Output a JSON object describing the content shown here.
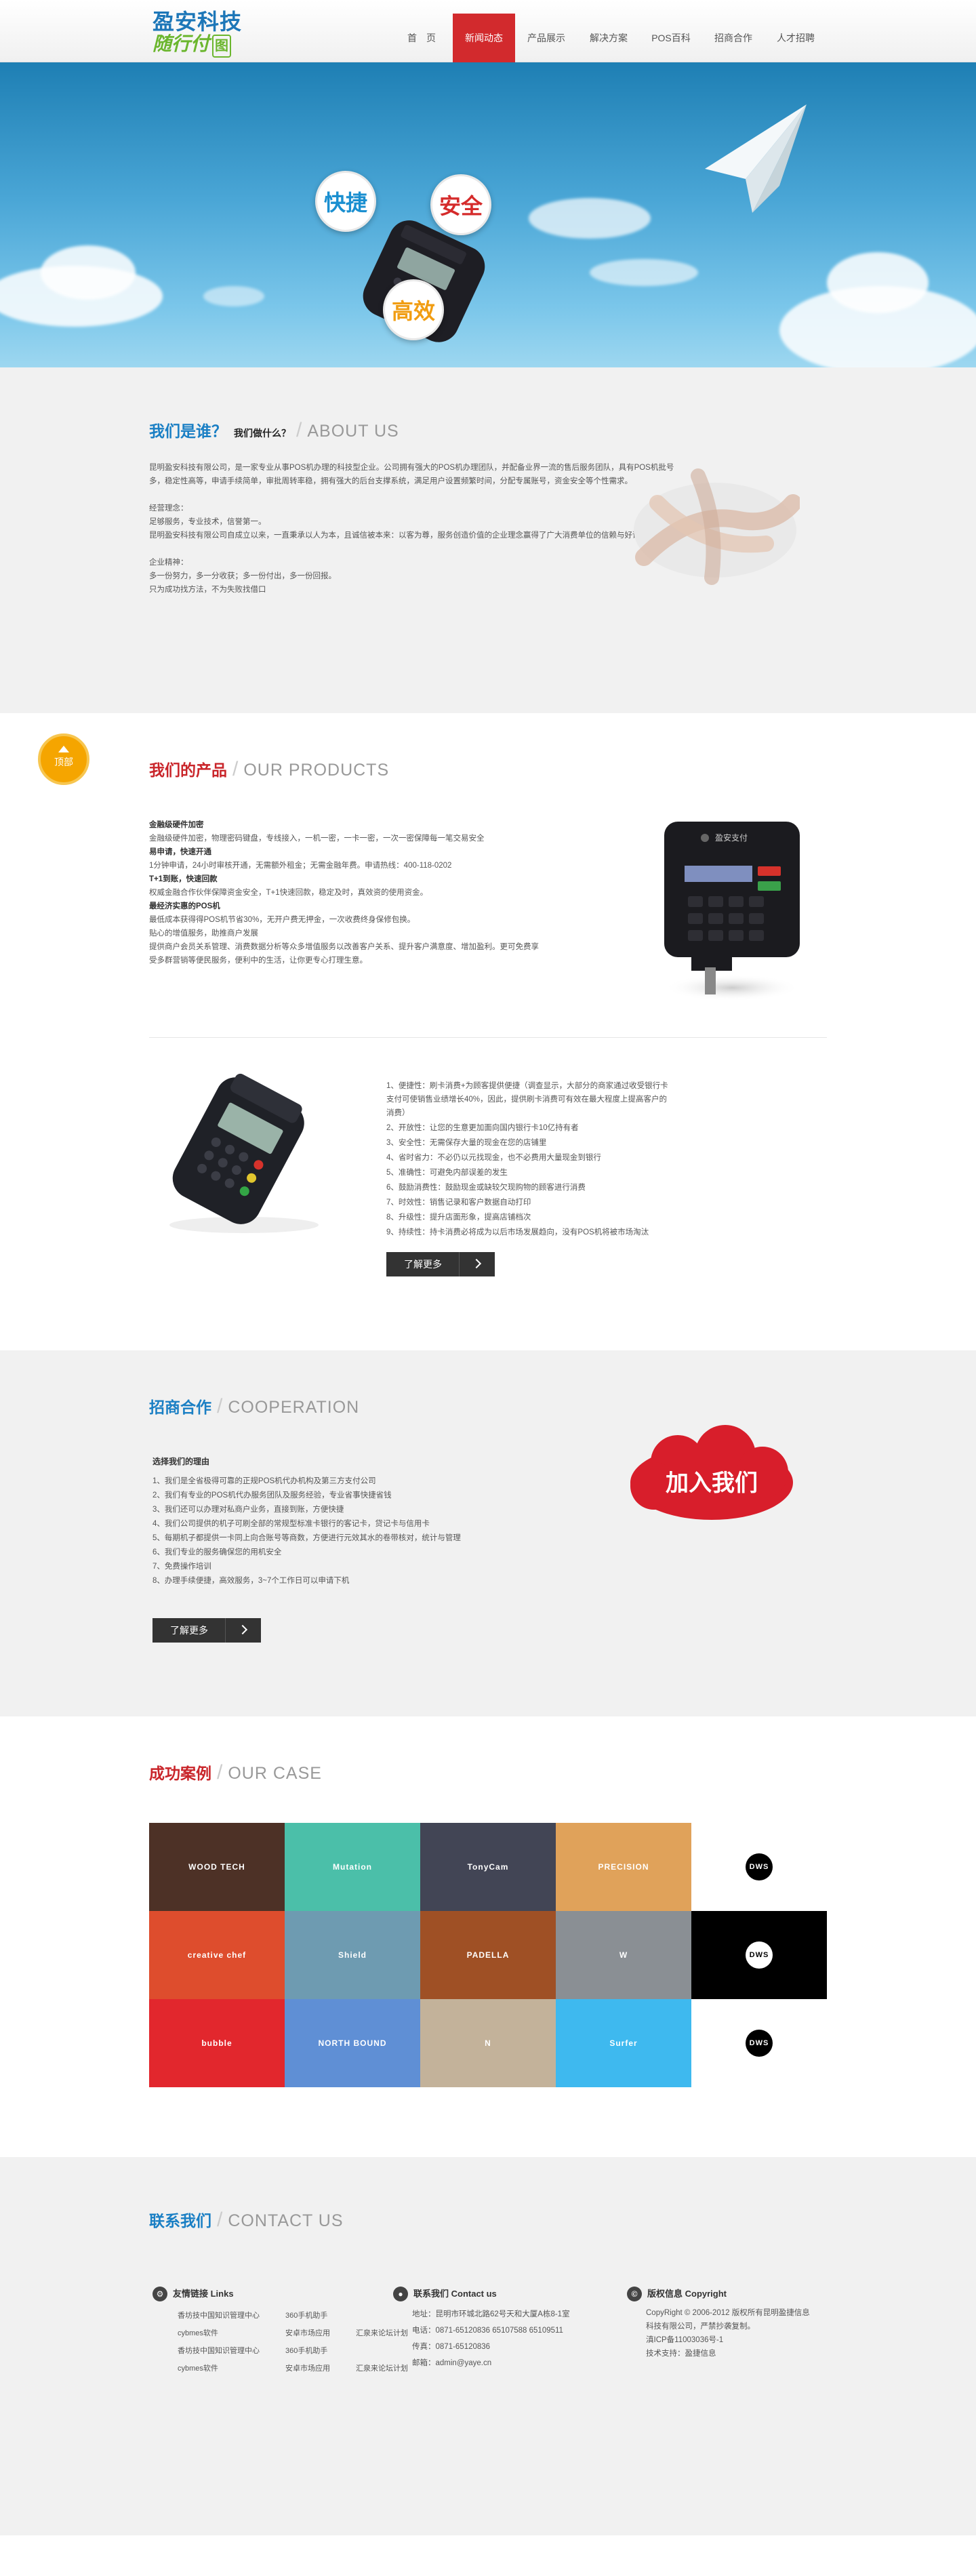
{
  "header": {
    "logo_line1": "盈安科技",
    "logo_line2": "随行付",
    "logo_badge": "图",
    "nav": [
      "首　页",
      "新闻动态",
      "产品展示",
      "解决方案",
      "POS百科",
      "招商合作",
      "人才招聘"
    ],
    "active_index": 1
  },
  "banner": {
    "bubble_fast": "快捷",
    "bubble_safe": "安全",
    "bubble_efficient": "高效"
  },
  "about": {
    "title_cn": "我们是谁？",
    "title_sub": "我们做什么？",
    "title_en": "ABOUT US",
    "p1": "昆明盈安科技有限公司，是一家专业从事POS机办理的科技型企业。公司拥有强大的POS机办理团队，并配备业界一流的售后服务团队，具有POS机批号多，稳定性高等，申请手续简单，审批周转率稳，拥有强大的后台支撑系统，满足用户设置频繁时间，分配专属账号，资金安全等个性需求。",
    "p2": "经营理念：",
    "p3": "足够服务，专业技术，信誉第一。",
    "p4": "昆明盈安科技有限公司自成立以来，一直秉承以人为本，且诚信被本来：以客为尊，服务创造价值的企业理念赢得了广大消费单位的信赖与好评。",
    "p5": "企业精神：",
    "p6": "多一份努力，多一分收获；多一份付出，多一份回报。",
    "p7": "只为成功找方法，不为失败找借口"
  },
  "top_badge": "顶部",
  "products": {
    "title_cn": "我们的产品",
    "title_en": "OUR PRODUCTS",
    "block1": [
      {
        "t": "金融级硬件加密",
        "b": true
      },
      {
        "t": "金融级硬件加密，物理密码键盘，专线接入，一机一密，一卡一密，一次一密保障每一笔交易安全",
        "b": false
      },
      {
        "t": "易申请，快速开通",
        "b": true
      },
      {
        "t": "1分钟申请，24小时审核开通，无需额外租金；无需金融年费。申请热线：400-118-0202",
        "b": false
      },
      {
        "t": "T+1到账，快速回款",
        "b": true
      },
      {
        "t": "权威金融合作伙伴保障资金安全，T+1快速回款，稳定及时，真效资的使用资金。",
        "b": false
      },
      {
        "t": "最经济实惠的POS机",
        "b": true
      },
      {
        "t": "最低成本获得得POS机节省30%，无开户费无押金，一次收费终身保修包换。",
        "b": false
      },
      {
        "t": "贴心的增值服务，助推商户发展",
        "b": false
      },
      {
        "t": "提供商户会员关系管理、消费数据分析等众多增值服务以改善客户关系、提升客户满意度、增加盈利。更可免费享",
        "b": false
      },
      {
        "t": "受多群营销等便民服务，便利中的生活，让你更专心打理生意。",
        "b": false
      }
    ],
    "device_brand": "盈安支付",
    "block2": [
      "1、便捷性：刷卡消费+为顾客提供便捷（调查显示，大部分的商家通过收受银行卡支付可使销售业绩增长40%，因此，提供刷卡消费可有效在最大程度上提高客户的消费）",
      "2、开放性：让您的生意更加面向国内银行卡10亿持有者",
      "3、安全性：无需保存大量的现金在您的店铺里",
      "4、省时省力：不必仍以元找现金，也不必费用大量现金到银行",
      "5、准确性：可避免内部误差的发生",
      "6、鼓励消费性：鼓励现金或缺较欠现购物的顾客进行消费",
      "7、时效性：销售记录和客户数据自动打印",
      "8、升级性：提升店面形象，提高店铺档次",
      "9、持续性：持卡消费必将成为以后市场发展趋向，没有POS机将被市场淘汰"
    ],
    "more": "了解更多"
  },
  "coop": {
    "title_cn": "招商合作",
    "title_en": "COOPERATION",
    "heading": "选择我们的理由",
    "items": [
      "1、我们是全省极得可靠的正规POS机代办机构及第三方支付公司",
      "2、我们有专业的POS机代办服务团队及服务经验，专业省事快捷省钱",
      "3、我们还可以办理对私商户业务，直接到账，方便快捷",
      "4、我们公司提供的机子可刷全部的常规型标准卡银行的客记卡，贷记卡与信用卡",
      "5、每期机子都提供一卡同上向合账号等商数，方便进行元效其水的卷带核对，统计与管理",
      "6、我们专业的服务确保您的用机安全",
      "7、免费操作培训",
      "8、办理手续便捷，高效服务，3~7个工作日可以申请下机"
    ],
    "join": "加入我们",
    "more": "了解更多"
  },
  "cases": {
    "title_cn": "成功案例",
    "title_en": "OUR CASE",
    "tiles": [
      {
        "label": "WOOD TECH",
        "bg": "#4d3126"
      },
      {
        "label": "Mutation",
        "bg": "#4bbfa9"
      },
      {
        "label": "TonyCam",
        "bg": "#424555"
      },
      {
        "label": "PRECISION",
        "bg": "#e0a25a"
      },
      {
        "label": "DWS",
        "bg": "#ffffff"
      },
      {
        "label": "creative chef",
        "bg": "#de4d2d"
      },
      {
        "label": "Shield",
        "bg": "#6e9bb1"
      },
      {
        "label": "PADELLA",
        "bg": "#9f5025"
      },
      {
        "label": "W",
        "bg": "#8a8f94"
      },
      {
        "label": "DWS",
        "bg": "#000000"
      },
      {
        "label": "bubble",
        "bg": "#e2272d"
      },
      {
        "label": "NORTH BOUND",
        "bg": "#5f8fd5"
      },
      {
        "label": "N",
        "bg": "#c3b29a"
      },
      {
        "label": "Surfer",
        "bg": "#3eb9ef"
      },
      {
        "label": "DWS",
        "bg": "#ffffff"
      }
    ]
  },
  "contact": {
    "title_cn": "联系我们",
    "title_en": "CONTACT US",
    "links_title": "友情链接  Links",
    "links": [
      [
        "香坊技中国知识管理中心",
        "360手机助手"
      ],
      [
        "cybmes软件",
        "安卓市场应用",
        "汇泉来论坛计划"
      ],
      [
        "香坊技中国知识管理中心",
        "360手机助手"
      ],
      [
        "cybmes软件",
        "安卓市场应用",
        "汇泉来论坛计划"
      ]
    ],
    "contact_title": "联系我们  Contact us",
    "address": "地址：昆明市环城北路62号天和大厦A栋8-1室",
    "phone": "电话：0871-65120836  65107588  65109511",
    "fax": "传真：0871-65120836",
    "email": "邮箱：admin@yaye.cn",
    "copy_title": "版权信息  Copyright",
    "copy1": "CopyRight © 2006-2012  版权所有昆明盈捷信息",
    "copy2": "科技有限公司，严禁抄袭复制。",
    "copy3": "滇ICP备11003036号-1",
    "copy4": "技术支持：盈捷信息"
  }
}
